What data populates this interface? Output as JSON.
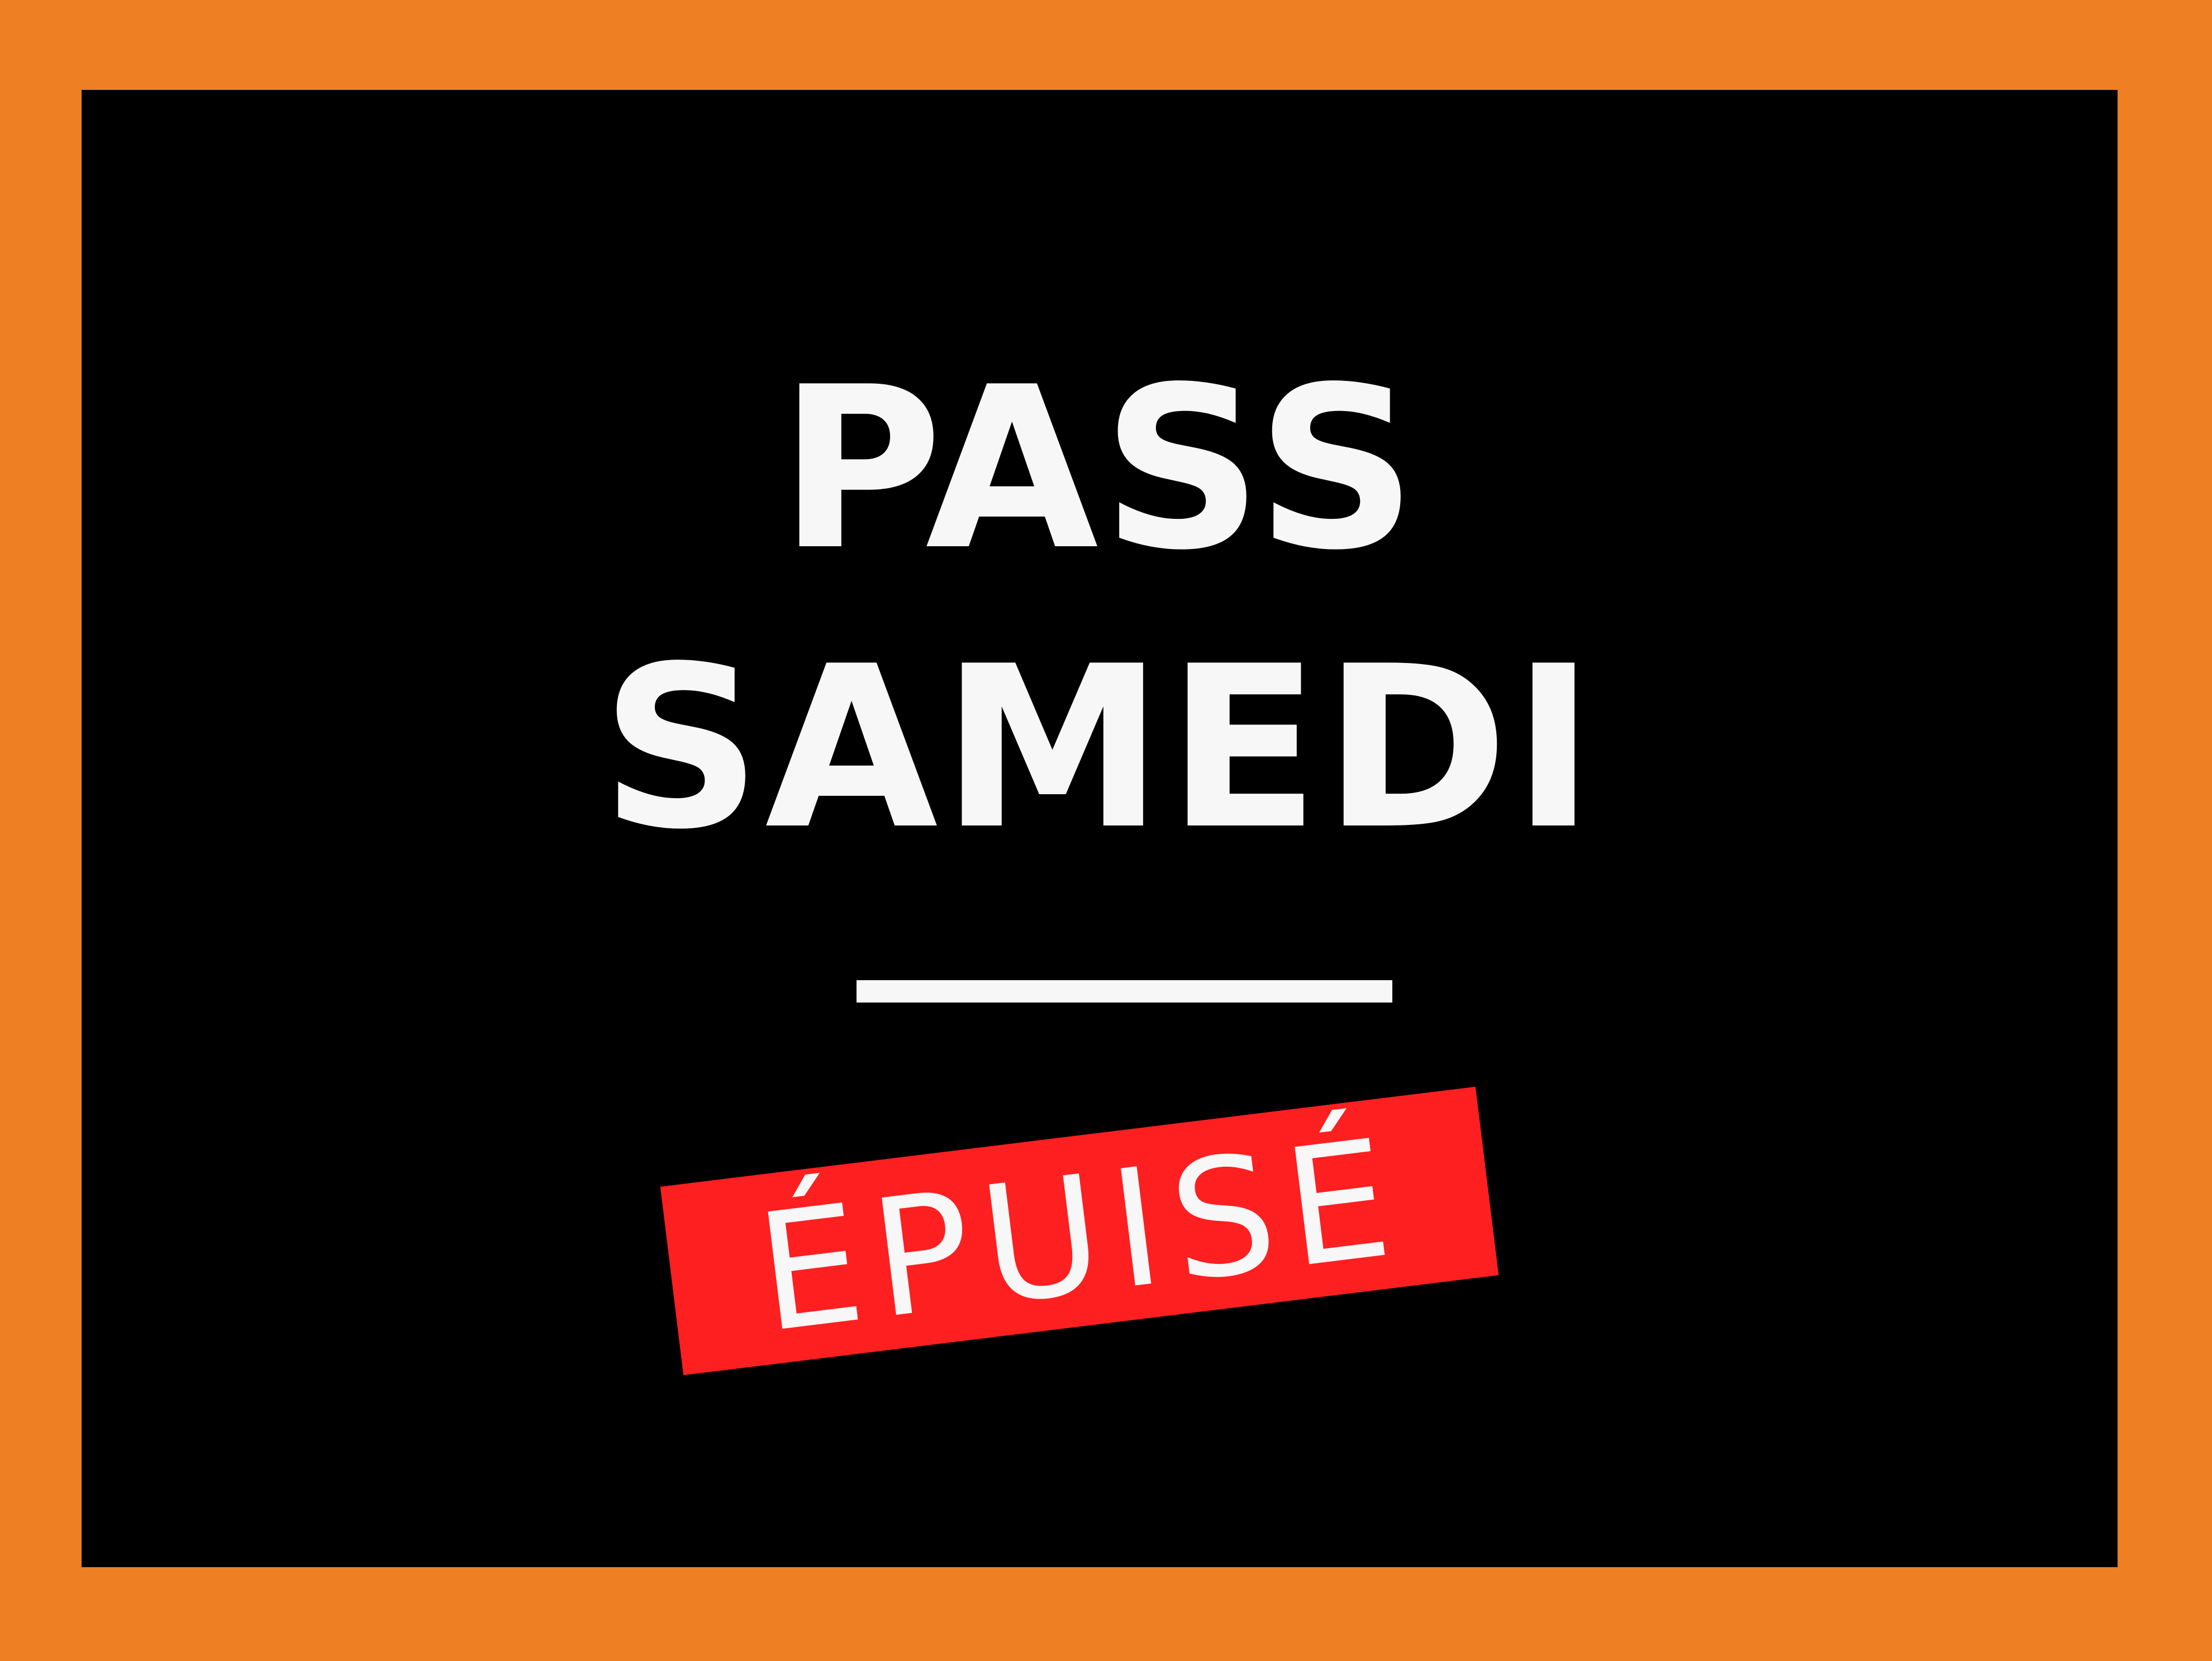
{
  "colors": {
    "frame": "#ee7f23",
    "panel": "#000000",
    "text": "#f7f7f7",
    "stamp": "#fe1f21"
  },
  "sign": {
    "title_line_1": "PASS",
    "title_line_2": "SAMEDI",
    "status_stamp": "ÉPUISÉ"
  }
}
